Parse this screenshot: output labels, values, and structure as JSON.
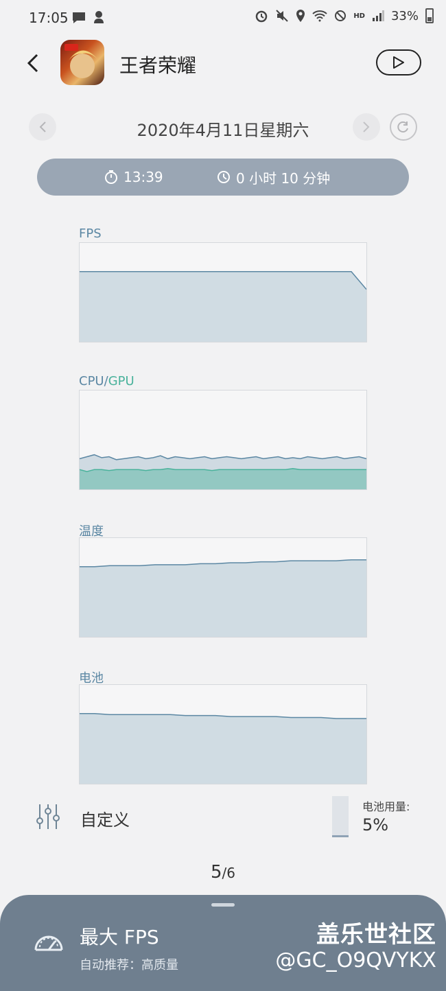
{
  "status_bar": {
    "time": "17:05",
    "battery": "33%",
    "network": "HD"
  },
  "header": {
    "app_name": "王者荣耀"
  },
  "date_nav": {
    "date": "2020年4月11日星期六"
  },
  "session": {
    "start_time": "13:39",
    "duration": "0 小时 10 分钟"
  },
  "charts": {
    "fps": {
      "label": "FPS",
      "color": "#5b87a3"
    },
    "cpu_gpu": {
      "label_cpu": "CPU",
      "sep": "/",
      "label_gpu": "GPU",
      "cpu_color": "#5b87a3",
      "gpu_color": "#49b29b"
    },
    "temp": {
      "label": "温度",
      "color": "#5b87a3"
    },
    "battery": {
      "label": "电池",
      "color": "#5b87a3"
    }
  },
  "chart_data": [
    {
      "type": "area",
      "title": "FPS",
      "x": [
        0,
        1,
        2,
        3,
        4,
        5,
        6,
        7,
        8,
        9,
        10,
        11,
        12,
        13,
        14,
        15,
        16,
        17,
        18,
        19
      ],
      "values": [
        71,
        71,
        71,
        71,
        71,
        71,
        71,
        71,
        71,
        71,
        71,
        71,
        71,
        71,
        71,
        71,
        71,
        71,
        71,
        53
      ],
      "ylim": [
        0,
        100
      ]
    },
    {
      "type": "area",
      "title": "CPU/GPU",
      "series": [
        {
          "name": "CPU",
          "values": [
            31,
            33,
            35,
            32,
            33,
            30,
            31,
            32,
            33,
            31,
            32,
            34,
            31,
            33,
            32,
            31,
            32,
            33,
            31,
            32,
            33,
            32,
            31,
            32,
            33,
            31,
            32,
            33,
            31,
            32,
            31,
            33,
            32,
            31,
            32,
            33,
            31,
            32,
            33,
            31
          ]
        },
        {
          "name": "GPU",
          "values": [
            20,
            18,
            20,
            20,
            19,
            20,
            20,
            20,
            20,
            19,
            20,
            20,
            21,
            20,
            20,
            20,
            20,
            20,
            19,
            20,
            20,
            20,
            20,
            20,
            20,
            20,
            20,
            20,
            20,
            21,
            20,
            20,
            20,
            20,
            20,
            20,
            20,
            20,
            20,
            20
          ]
        }
      ],
      "ylim": [
        0,
        100
      ]
    },
    {
      "type": "area",
      "title": "温度",
      "x": [
        0,
        1,
        2,
        3,
        4,
        5,
        6,
        7,
        8,
        9,
        10,
        11,
        12,
        13,
        14,
        15,
        16,
        17,
        18,
        19
      ],
      "values": [
        71,
        71,
        72,
        72,
        72,
        73,
        73,
        73,
        74,
        74,
        75,
        75,
        76,
        76,
        77,
        77,
        77,
        77,
        78,
        78
      ],
      "ylim": [
        0,
        100
      ]
    },
    {
      "type": "area",
      "title": "电池",
      "x": [
        0,
        1,
        2,
        3,
        4,
        5,
        6,
        7,
        8,
        9,
        10,
        11,
        12,
        13,
        14,
        15,
        16,
        17,
        18,
        19
      ],
      "values": [
        71,
        71,
        70,
        70,
        70,
        70,
        70,
        69,
        69,
        69,
        68,
        68,
        68,
        68,
        67,
        67,
        67,
        66,
        66,
        66
      ],
      "ylim": [
        0,
        100
      ]
    }
  ],
  "customize": {
    "label": "自定义"
  },
  "battery_usage": {
    "label": "电池用量:",
    "value": "5%",
    "fraction": 0.05
  },
  "pager": {
    "current": "5",
    "total": "/6"
  },
  "bottom_sheet": {
    "title": "最大 FPS",
    "subtitle": "自动推荐：高质量"
  },
  "watermark": {
    "line1": "盖乐世社区",
    "line2": "@GC_O9QVYKX"
  }
}
